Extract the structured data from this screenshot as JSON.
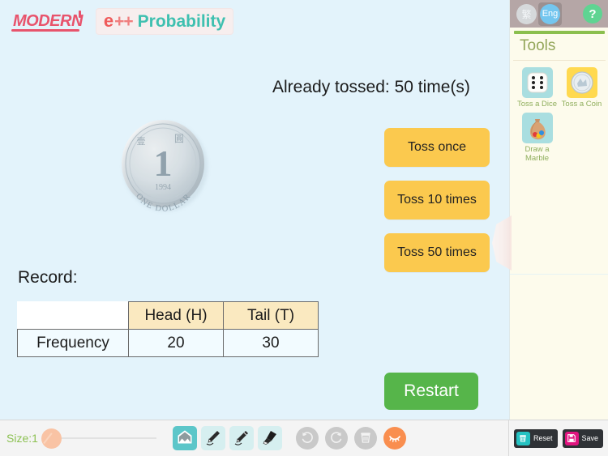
{
  "brand": {
    "modern": "MODERN",
    "e": "e",
    "plus": "++",
    "probability": "Probability"
  },
  "header_panel": {
    "lang_zh": "繁",
    "lang_en": "Eng",
    "help": "?"
  },
  "tools_panel": {
    "title": "Tools",
    "items": [
      {
        "label": "Toss a Dice",
        "icon": "dice-icon"
      },
      {
        "label": "Toss a Coin",
        "icon": "coin-icon"
      },
      {
        "label": "Draw a Marble",
        "icon": "marble-bag-icon"
      }
    ]
  },
  "main": {
    "toss_status": "Already tossed: 50 time(s)",
    "coin": {
      "denomination": "1",
      "year": "1994",
      "legend": "ONE DOLLAR",
      "chinese_left": "壹",
      "chinese_right": "圓"
    },
    "buttons": {
      "toss_once": "Toss once",
      "toss_10": "Toss 10 times",
      "toss_50": "Toss 50 times",
      "restart": "Restart"
    },
    "record": {
      "label": "Record:",
      "columns": [
        "",
        "Head (H)",
        "Tail (T)"
      ],
      "rows": [
        {
          "name": "Frequency",
          "values": [
            "20",
            "30"
          ]
        }
      ]
    }
  },
  "toolbar": {
    "size_label": "Size:1",
    "draw_tools": [
      {
        "name": "shape-tool",
        "active": true
      },
      {
        "name": "pencil-tool",
        "active": false
      },
      {
        "name": "pen-tool",
        "active": false
      },
      {
        "name": "marker-tool",
        "active": false
      }
    ],
    "action_tools": [
      {
        "name": "undo"
      },
      {
        "name": "redo"
      },
      {
        "name": "clear"
      },
      {
        "name": "eraser"
      }
    ],
    "reset_label": "Reset",
    "save_label": "Save"
  },
  "colors": {
    "background": "#e3f3fb",
    "button_yellow": "#fbc94e",
    "button_green": "#56b54a",
    "table_header": "#fae9c0",
    "panel_bg": "#fdfbec",
    "accent_green": "#8bbf4e",
    "brand_red": "#ef5b5b",
    "brand_teal": "#3fc0b0",
    "save_pink": "#e0147f",
    "reset_teal": "#25c2c2"
  }
}
